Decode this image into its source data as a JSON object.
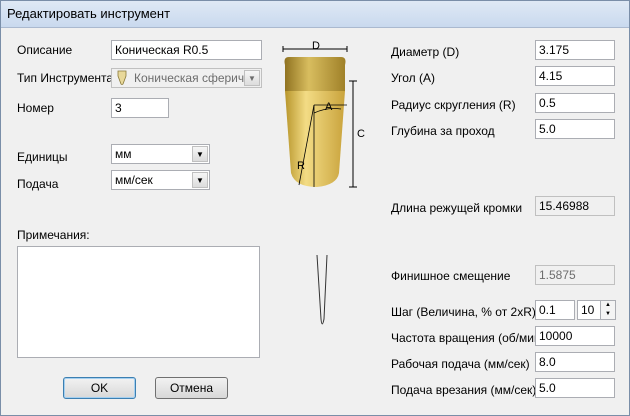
{
  "window": {
    "title": "Редактировать инструмент"
  },
  "left": {
    "description_label": "Описание",
    "description_value": "Коническая R0.5",
    "tool_type_label": "Тип Инструмента",
    "tool_type_value": "Коническая сферичес",
    "number_label": "Номер",
    "number_value": "3",
    "units_label": "Единицы",
    "units_value": "мм",
    "feed_label": "Подача",
    "feed_value": "мм/сек",
    "notes_label": "Примечания:",
    "notes_value": ""
  },
  "diagram": {
    "label_d": "D",
    "label_a": "A",
    "label_c": "C",
    "label_r": "R",
    "tool_color": "#d9b64a"
  },
  "right": {
    "diameter_label": "Диаметр (D)",
    "diameter_value": "3.175",
    "angle_label": "Угол (A)",
    "angle_value": "4.15",
    "radius_label": "Радиус скругления (R)",
    "radius_value": "0.5",
    "depth_label": "Глубина за проход",
    "depth_value": "5.0",
    "edge_label": "Длина режущей кромки",
    "edge_value": "15.46988",
    "finish_label": "Финишное смещение",
    "finish_value": "1.5875",
    "step_label": "Шаг (Величина, % от 2xR)",
    "step_value": "0.1",
    "step_pct_value": "10",
    "spindle_label": "Частота вращения (об/мин)",
    "spindle_value": "10000",
    "work_feed_label": "Рабочая подача (мм/сек)",
    "work_feed_value": "8.0",
    "plunge_label": "Подача врезания (мм/сек)",
    "plunge_value": "5.0"
  },
  "buttons": {
    "ok": "OK",
    "cancel": "Отмена"
  }
}
